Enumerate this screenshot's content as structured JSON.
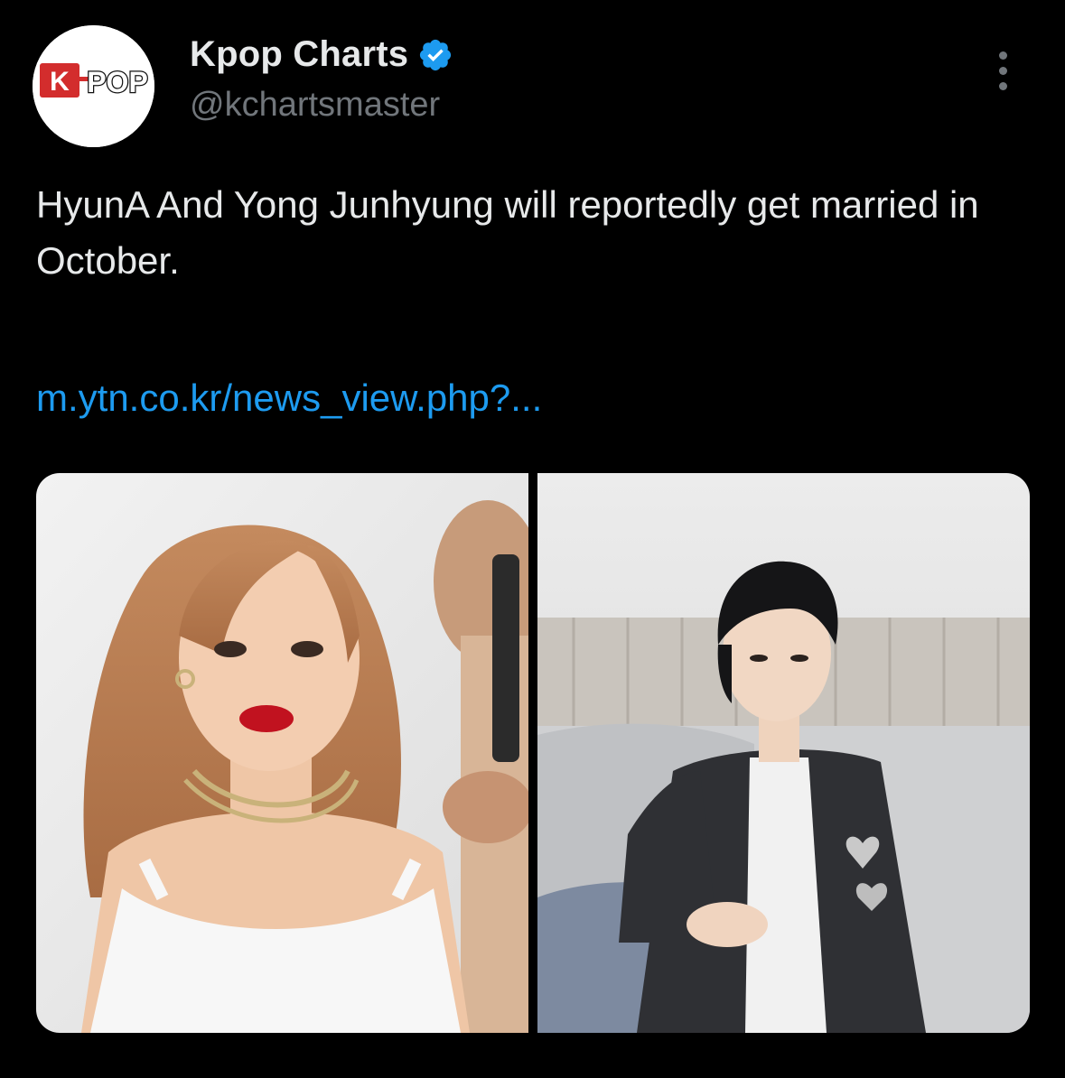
{
  "account": {
    "display_name": "Kpop Charts",
    "handle": "@kchartsmaster",
    "avatar_text": "K-POP",
    "verified": true,
    "verified_color": "#1d9bf0"
  },
  "tweet": {
    "text": "HyunA And Yong Junhyung will reportedly get married in October.",
    "link": "m.ytn.co.kr/news_view.php?..."
  },
  "media": {
    "photos": [
      {
        "name": "photo-1",
        "icon": "portrait-woman"
      },
      {
        "name": "photo-2",
        "icon": "portrait-man"
      }
    ]
  },
  "colors": {
    "background": "#000000",
    "text": "#e7e9ea",
    "secondary": "#71767b",
    "link": "#1d9bf0",
    "avatar_red": "#d32d2d"
  }
}
